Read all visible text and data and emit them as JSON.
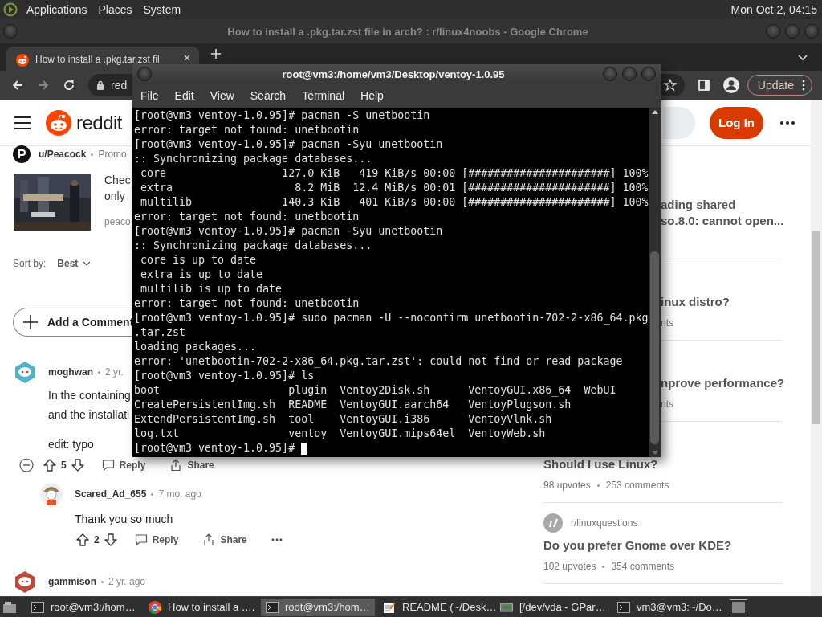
{
  "top_panel": {
    "menus": [
      "Applications",
      "Places",
      "System"
    ],
    "clock": "Mon Oct 2, 04:15"
  },
  "browser": {
    "title": "How to install a .pkg.tar.zst file in arch? : r/linux4noobs - Google Chrome",
    "tabs": [
      {
        "label": "How to install a .pkg.tar.zst fil",
        "selected": true
      }
    ],
    "address": "red",
    "update": "Update",
    "page": {
      "brand": "reddit",
      "login": "Log In",
      "ad": {
        "author": "u/Peacock",
        "tag": "Promo",
        "lines": [
          "Chec",
          "only"
        ],
        "domain": "peaco"
      },
      "sort": {
        "label": "Sort by:",
        "value": "Best"
      },
      "add_comment": "Add a Comment",
      "comments": [
        {
          "author": "moghwan",
          "age": "2 yr.",
          "body": [
            "In the containing",
            "and the installati"
          ],
          "note": "edit: typo",
          "votes": "5",
          "reply": "Reply",
          "share": "Share",
          "replies": [
            {
              "author": "Scared_Ad_655",
              "age": "7 mo. ago",
              "body": [
                "Thank you so much"
              ],
              "votes": "2",
              "reply": "Reply",
              "share": "Share",
              "more": true
            }
          ]
        },
        {
          "author": "gammison",
          "age": "2 yr. ago"
        }
      ],
      "related": [
        {
          "title_lines": [
            "ading shared",
            "so.8.0: cannot open..."
          ]
        },
        {
          "title_lines": [
            "inux distro?"
          ],
          "meta": "nts"
        },
        {
          "title_lines": [
            "nprove performance?"
          ],
          "meta": "nts"
        },
        {
          "title_lines": [
            "Should I use Linux?"
          ],
          "upvotes": "98 upvotes",
          "comments": "253 comments"
        },
        {
          "community": "r/linuxquestions",
          "title_lines": [
            "Do you prefer Gnome over KDE?"
          ],
          "upvotes": "102 upvotes",
          "comments": "354 comments"
        }
      ]
    }
  },
  "terminal": {
    "title": "root@vm3:/home/vm3/Desktop/ventoy-1.0.95",
    "menus": [
      "File",
      "Edit",
      "View",
      "Search",
      "Terminal",
      "Help"
    ],
    "lines": [
      "[root@vm3 ventoy-1.0.95]# pacman -S unetbootin",
      "error: target not found: unetbootin",
      "[root@vm3 ventoy-1.0.95]# pacman -Syu unetbootin",
      ":: Synchronizing package databases...",
      " core                  127.0 KiB   419 KiB/s 00:00 [######################] 100%",
      " extra                   8.2 MiB  12.4 MiB/s 00:01 [######################] 100%",
      " multilib              140.3 KiB   401 KiB/s 00:00 [######################] 100%",
      "error: target not found: unetbootin",
      "[root@vm3 ventoy-1.0.95]# pacman -Syu unetbootin",
      ":: Synchronizing package databases...",
      " core is up to date",
      " extra is up to date",
      " multilib is up to date",
      "error: target not found: unetbootin",
      "[root@vm3 ventoy-1.0.95]# sudo pacman -U --noconfirm unetbootin-702-2-x86_64.pkg",
      ".tar.zst",
      "loading packages...",
      "error: 'unetbootin-702-2-x86_64.pkg.tar.zst': could not find or read package",
      "[root@vm3 ventoy-1.0.95]# ls",
      "boot                    plugin  Ventoy2Disk.sh      VentoyGUI.x86_64  WebUI",
      "CreatePersistentImg.sh  README  VentoyGUI.aarch64   VentoyPlugson.sh",
      "ExtendPersistentImg.sh  tool    VentoyGUI.i386      VentoyVlnk.sh",
      "log.txt                 ventoy  VentoyGUI.mips64el  VentoyWeb.sh",
      "[root@vm3 ventoy-1.0.95]# "
    ],
    "cursor_visible": true
  },
  "taskbar": {
    "items": [
      {
        "kind": "terminal",
        "label": "root@vm3:/hom…",
        "selected": false
      },
      {
        "kind": "chrome",
        "label": "How to install a ….",
        "selected": false
      },
      {
        "kind": "terminal",
        "label": "root@vm3:/hom…",
        "selected": true
      },
      {
        "kind": "editor",
        "label": "README (~/Desk…",
        "selected": false
      },
      {
        "kind": "disk",
        "label": "[/dev/vda - GPar…",
        "selected": false
      },
      {
        "kind": "terminal",
        "label": "vm3@vm3:~/Do…",
        "selected": false
      }
    ]
  }
}
